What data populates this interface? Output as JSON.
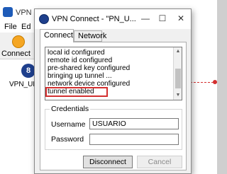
{
  "background_app": {
    "title": "VPN",
    "menu": [
      "File",
      "Ed"
    ],
    "toolbar_label": "Connect",
    "vpn_item_label": "VPN_UFR"
  },
  "dialog": {
    "title": "VPN Connect - \"PN_U...",
    "min_glyph": "—",
    "max_glyph": "☐",
    "close_glyph": "✕",
    "tabs": [
      {
        "label": "Connect",
        "active": true
      },
      {
        "label": "Network",
        "active": false
      }
    ],
    "log_lines": [
      "local id configured",
      "remote id configured",
      "pre-shared key configured",
      "bringing up tunnel ...",
      "network device configured",
      "tunnel enabled"
    ],
    "highlighted_line": "tunnel enabled",
    "credentials": {
      "legend": "Credentials",
      "username_label": "Username",
      "username_value": "USUARIO",
      "password_label": "Password",
      "password_value": ""
    },
    "buttons": {
      "disconnect": "Disconnect",
      "cancel": "Cancel"
    }
  },
  "colors": {
    "highlight": "#d32f2f",
    "dialog_bg": "#f0f0f0"
  }
}
